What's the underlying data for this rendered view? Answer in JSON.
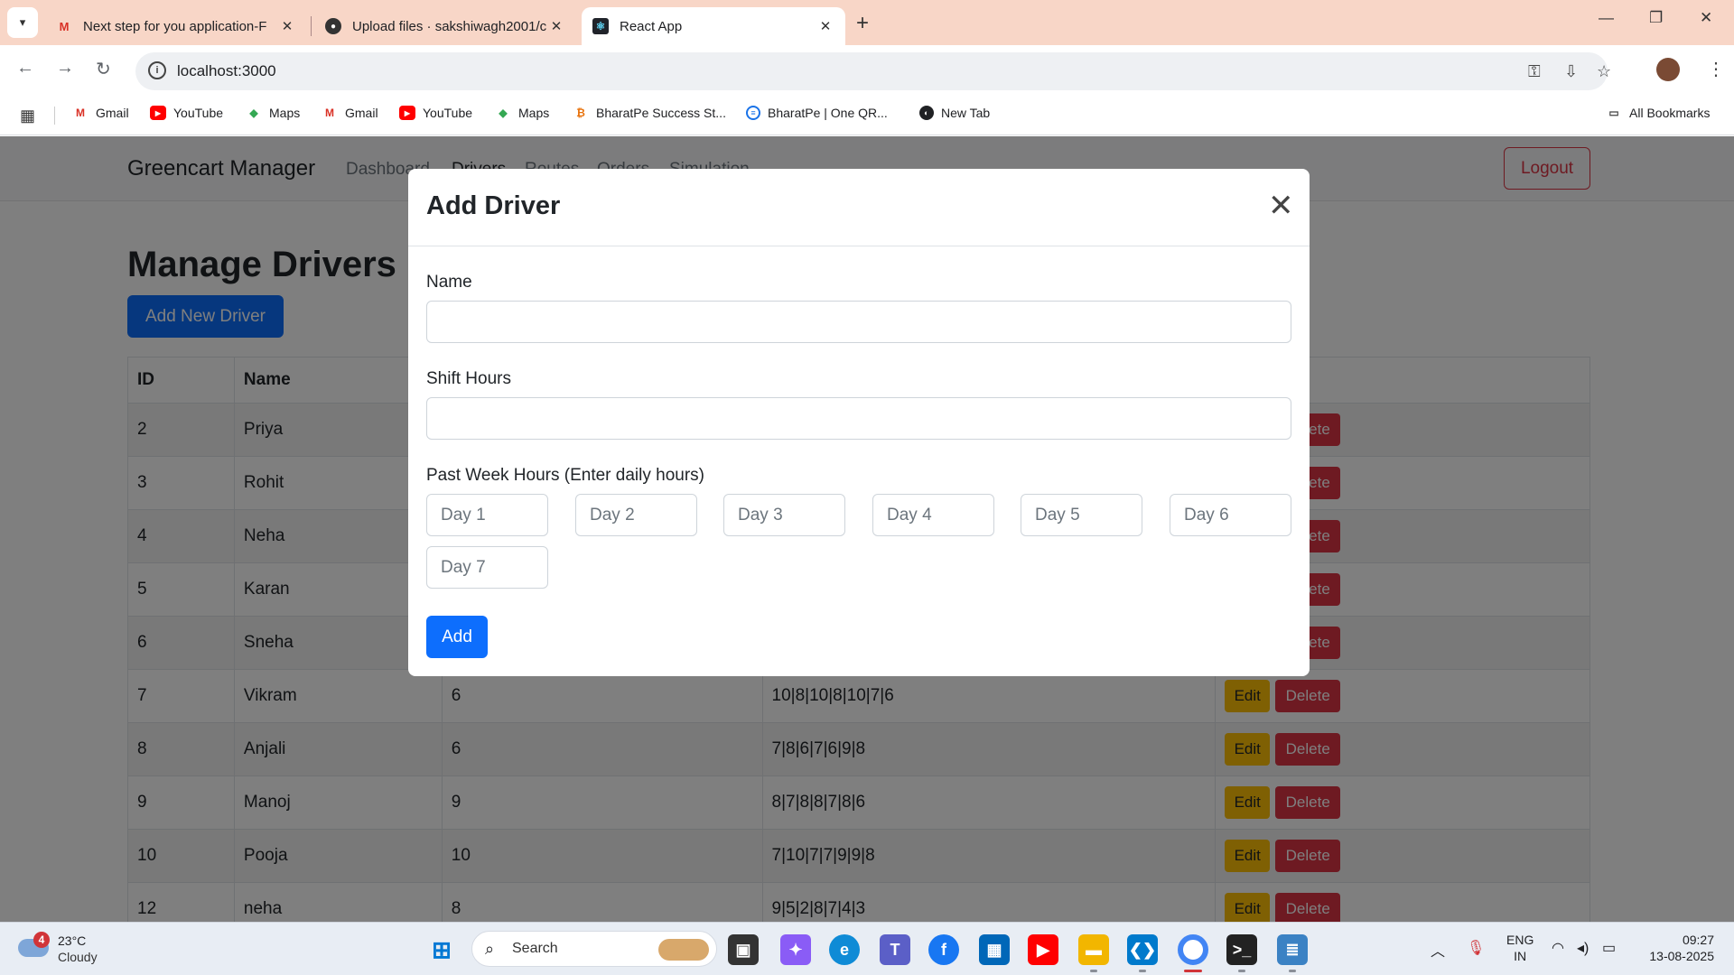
{
  "browser": {
    "tabs": [
      {
        "title": "Next step for you application-F",
        "icon": "gmail-icon"
      },
      {
        "title": "Upload files · sakshiwagh2001/c",
        "icon": "github-icon"
      },
      {
        "title": "React App",
        "icon": "react-icon"
      }
    ],
    "url": "localhost:3000",
    "bookmarks": [
      "Gmail",
      "YouTube",
      "Maps",
      "Gmail",
      "YouTube",
      "Maps",
      "BharatPe Success St...",
      "BharatPe | One QR...",
      "New Tab"
    ],
    "all_bookmarks": "All Bookmarks"
  },
  "app": {
    "brand": "Greencart Manager",
    "nav": [
      "Dashboard",
      "Drivers",
      "Routes",
      "Orders",
      "Simulation"
    ],
    "logout": "Logout",
    "heading": "Manage Drivers",
    "add_new": "Add New Driver"
  },
  "table": {
    "headers": [
      "ID",
      "Name",
      "",
      "",
      ""
    ],
    "rows": [
      {
        "id": "2",
        "name": "Priya",
        "shift": "",
        "past": ""
      },
      {
        "id": "3",
        "name": "Rohit",
        "shift": "",
        "past": ""
      },
      {
        "id": "4",
        "name": "Neha",
        "shift": "",
        "past": ""
      },
      {
        "id": "5",
        "name": "Karan",
        "shift": "",
        "past": ""
      },
      {
        "id": "6",
        "name": "Sneha",
        "shift": "",
        "past": ""
      },
      {
        "id": "7",
        "name": "Vikram",
        "shift": "6",
        "past": "10|8|10|8|10|7|6"
      },
      {
        "id": "8",
        "name": "Anjali",
        "shift": "6",
        "past": "7|8|6|7|6|9|8"
      },
      {
        "id": "9",
        "name": "Manoj",
        "shift": "9",
        "past": "8|7|8|8|7|8|6"
      },
      {
        "id": "10",
        "name": "Pooja",
        "shift": "10",
        "past": "7|10|7|7|9|9|8"
      },
      {
        "id": "12",
        "name": "neha",
        "shift": "8",
        "past": "9|5|2|8|7|4|3"
      }
    ],
    "edit": "Edit",
    "delete": "Delete"
  },
  "modal": {
    "title": "Add Driver",
    "name_label": "Name",
    "name_value": "",
    "shift_label": "Shift Hours",
    "shift_value": "",
    "past_label": "Past Week Hours (Enter daily hours)",
    "day_placeholders": [
      "Day 1",
      "Day 2",
      "Day 3",
      "Day 4",
      "Day 5",
      "Day 6",
      "Day 7"
    ],
    "submit": "Add"
  },
  "taskbar": {
    "weather_badge": "4",
    "temp": "23°C",
    "condition": "Cloudy",
    "search": "Search",
    "lang1": "ENG",
    "lang2": "IN",
    "time": "09:27",
    "date": "13-08-2025"
  },
  "colors": {
    "primary": "#0d6efd",
    "danger": "#dc3545",
    "warning": "#ffc107",
    "tabbar": "#f8d6c7"
  }
}
